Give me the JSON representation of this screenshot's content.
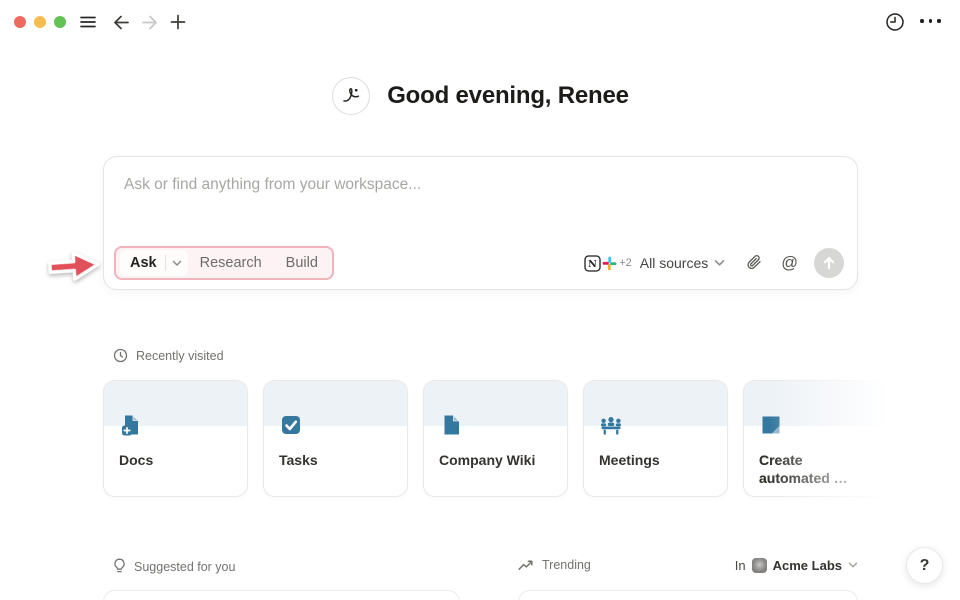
{
  "topbar": {
    "traffic_lights": {
      "red": "#ee6a5f",
      "yellow": "#f5bd4f",
      "green": "#61c354"
    }
  },
  "greeting": {
    "text": "Good evening, Renee"
  },
  "ask_box": {
    "placeholder": "Ask or find anything from your workspace...",
    "modes": [
      {
        "label": "Ask",
        "selected": true
      },
      {
        "label": "Research",
        "selected": false
      },
      {
        "label": "Build",
        "selected": false
      }
    ],
    "sources": {
      "notion_glyph": "N",
      "extra_count": "+2",
      "label": "All sources",
      "at_symbol": "@"
    }
  },
  "recently_visited": {
    "title": "Recently visited",
    "cards": [
      {
        "title": "Docs",
        "icon": "doc-plus-icon"
      },
      {
        "title": "Tasks",
        "icon": "checkbox-icon"
      },
      {
        "title": "Company Wiki",
        "icon": "document-icon"
      },
      {
        "title": "Meetings",
        "icon": "people-icon"
      },
      {
        "title": "Create automated …",
        "icon": "note-icon"
      }
    ]
  },
  "bottom": {
    "suggested_title": "Suggested for you",
    "trending_title": "Trending",
    "workspace_prefix": "In",
    "workspace_name": "Acme Labs",
    "help_label": "?"
  },
  "colors": {
    "accent_blue": "#35789f",
    "card_band": "#edf2f7",
    "annotation_red": "#e25059",
    "annotation_border": "#f1b4ba"
  }
}
